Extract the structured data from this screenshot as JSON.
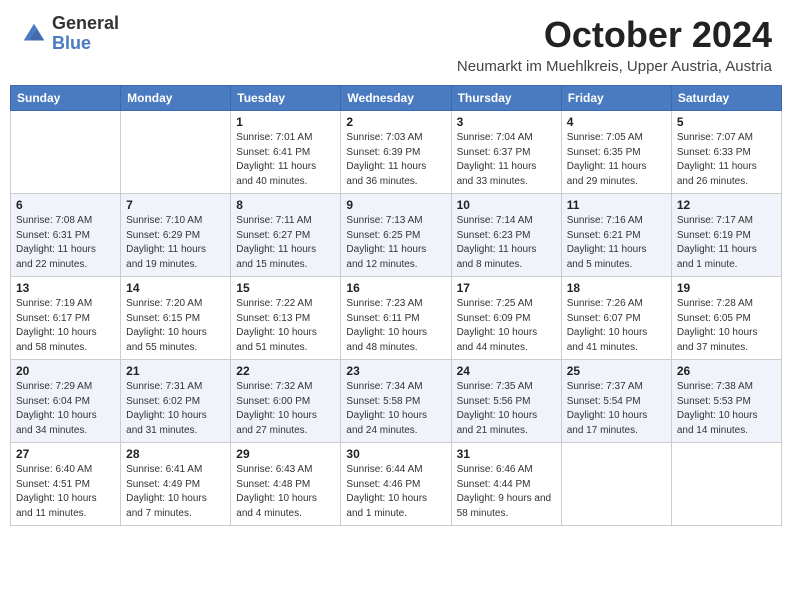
{
  "header": {
    "logo_general": "General",
    "logo_blue": "Blue",
    "month_title": "October 2024",
    "subtitle": "Neumarkt im Muehlkreis, Upper Austria, Austria"
  },
  "days_of_week": [
    "Sunday",
    "Monday",
    "Tuesday",
    "Wednesday",
    "Thursday",
    "Friday",
    "Saturday"
  ],
  "weeks": [
    [
      {
        "day": "",
        "detail": ""
      },
      {
        "day": "",
        "detail": ""
      },
      {
        "day": "1",
        "detail": "Sunrise: 7:01 AM\nSunset: 6:41 PM\nDaylight: 11 hours and 40 minutes."
      },
      {
        "day": "2",
        "detail": "Sunrise: 7:03 AM\nSunset: 6:39 PM\nDaylight: 11 hours and 36 minutes."
      },
      {
        "day": "3",
        "detail": "Sunrise: 7:04 AM\nSunset: 6:37 PM\nDaylight: 11 hours and 33 minutes."
      },
      {
        "day": "4",
        "detail": "Sunrise: 7:05 AM\nSunset: 6:35 PM\nDaylight: 11 hours and 29 minutes."
      },
      {
        "day": "5",
        "detail": "Sunrise: 7:07 AM\nSunset: 6:33 PM\nDaylight: 11 hours and 26 minutes."
      }
    ],
    [
      {
        "day": "6",
        "detail": "Sunrise: 7:08 AM\nSunset: 6:31 PM\nDaylight: 11 hours and 22 minutes."
      },
      {
        "day": "7",
        "detail": "Sunrise: 7:10 AM\nSunset: 6:29 PM\nDaylight: 11 hours and 19 minutes."
      },
      {
        "day": "8",
        "detail": "Sunrise: 7:11 AM\nSunset: 6:27 PM\nDaylight: 11 hours and 15 minutes."
      },
      {
        "day": "9",
        "detail": "Sunrise: 7:13 AM\nSunset: 6:25 PM\nDaylight: 11 hours and 12 minutes."
      },
      {
        "day": "10",
        "detail": "Sunrise: 7:14 AM\nSunset: 6:23 PM\nDaylight: 11 hours and 8 minutes."
      },
      {
        "day": "11",
        "detail": "Sunrise: 7:16 AM\nSunset: 6:21 PM\nDaylight: 11 hours and 5 minutes."
      },
      {
        "day": "12",
        "detail": "Sunrise: 7:17 AM\nSunset: 6:19 PM\nDaylight: 11 hours and 1 minute."
      }
    ],
    [
      {
        "day": "13",
        "detail": "Sunrise: 7:19 AM\nSunset: 6:17 PM\nDaylight: 10 hours and 58 minutes."
      },
      {
        "day": "14",
        "detail": "Sunrise: 7:20 AM\nSunset: 6:15 PM\nDaylight: 10 hours and 55 minutes."
      },
      {
        "day": "15",
        "detail": "Sunrise: 7:22 AM\nSunset: 6:13 PM\nDaylight: 10 hours and 51 minutes."
      },
      {
        "day": "16",
        "detail": "Sunrise: 7:23 AM\nSunset: 6:11 PM\nDaylight: 10 hours and 48 minutes."
      },
      {
        "day": "17",
        "detail": "Sunrise: 7:25 AM\nSunset: 6:09 PM\nDaylight: 10 hours and 44 minutes."
      },
      {
        "day": "18",
        "detail": "Sunrise: 7:26 AM\nSunset: 6:07 PM\nDaylight: 10 hours and 41 minutes."
      },
      {
        "day": "19",
        "detail": "Sunrise: 7:28 AM\nSunset: 6:05 PM\nDaylight: 10 hours and 37 minutes."
      }
    ],
    [
      {
        "day": "20",
        "detail": "Sunrise: 7:29 AM\nSunset: 6:04 PM\nDaylight: 10 hours and 34 minutes."
      },
      {
        "day": "21",
        "detail": "Sunrise: 7:31 AM\nSunset: 6:02 PM\nDaylight: 10 hours and 31 minutes."
      },
      {
        "day": "22",
        "detail": "Sunrise: 7:32 AM\nSunset: 6:00 PM\nDaylight: 10 hours and 27 minutes."
      },
      {
        "day": "23",
        "detail": "Sunrise: 7:34 AM\nSunset: 5:58 PM\nDaylight: 10 hours and 24 minutes."
      },
      {
        "day": "24",
        "detail": "Sunrise: 7:35 AM\nSunset: 5:56 PM\nDaylight: 10 hours and 21 minutes."
      },
      {
        "day": "25",
        "detail": "Sunrise: 7:37 AM\nSunset: 5:54 PM\nDaylight: 10 hours and 17 minutes."
      },
      {
        "day": "26",
        "detail": "Sunrise: 7:38 AM\nSunset: 5:53 PM\nDaylight: 10 hours and 14 minutes."
      }
    ],
    [
      {
        "day": "27",
        "detail": "Sunrise: 6:40 AM\nSunset: 4:51 PM\nDaylight: 10 hours and 11 minutes."
      },
      {
        "day": "28",
        "detail": "Sunrise: 6:41 AM\nSunset: 4:49 PM\nDaylight: 10 hours and 7 minutes."
      },
      {
        "day": "29",
        "detail": "Sunrise: 6:43 AM\nSunset: 4:48 PM\nDaylight: 10 hours and 4 minutes."
      },
      {
        "day": "30",
        "detail": "Sunrise: 6:44 AM\nSunset: 4:46 PM\nDaylight: 10 hours and 1 minute."
      },
      {
        "day": "31",
        "detail": "Sunrise: 6:46 AM\nSunset: 4:44 PM\nDaylight: 9 hours and 58 minutes."
      },
      {
        "day": "",
        "detail": ""
      },
      {
        "day": "",
        "detail": ""
      }
    ]
  ]
}
